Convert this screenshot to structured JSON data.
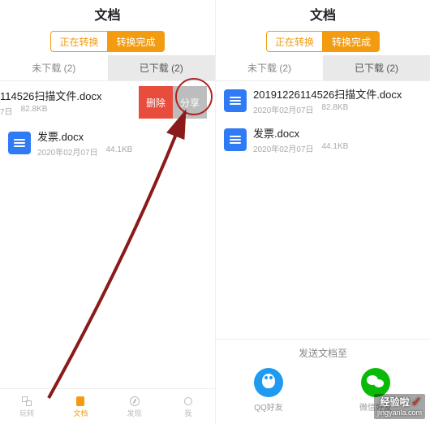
{
  "left": {
    "title": "文档",
    "seg_converting": "正在转换",
    "seg_done": "转换完成",
    "tab_not_downloaded": "未下载 (2)",
    "tab_downloaded": "已下载 (2)",
    "row1": {
      "title_fragment": "114526扫描文件.docx",
      "date_fragment": "7日",
      "size": "82.8KB",
      "delete": "删除",
      "share": "分享"
    },
    "row2": {
      "title": "发票.docx",
      "date": "2020年02月07日",
      "size": "44.1KB"
    },
    "nav": {
      "play": "玩转",
      "doc": "文档",
      "discover": "发现",
      "me": "我"
    }
  },
  "right": {
    "title": "文档",
    "seg_converting": "正在转换",
    "seg_done": "转换完成",
    "tab_not_downloaded": "未下载 (2)",
    "tab_downloaded": "已下载 (2)",
    "row1": {
      "title": "20191226114526扫描文件.docx",
      "date": "2020年02月07日",
      "size": "82.8KB"
    },
    "row2": {
      "title": "发票.docx",
      "date": "2020年02月07日",
      "size": "44.1KB"
    },
    "sheet": {
      "title": "发送文档至",
      "qq": "QQ好友",
      "wechat": "微信好友"
    }
  },
  "watermark": {
    "brand": "经验啦",
    "domain": "jingyanla.com"
  }
}
